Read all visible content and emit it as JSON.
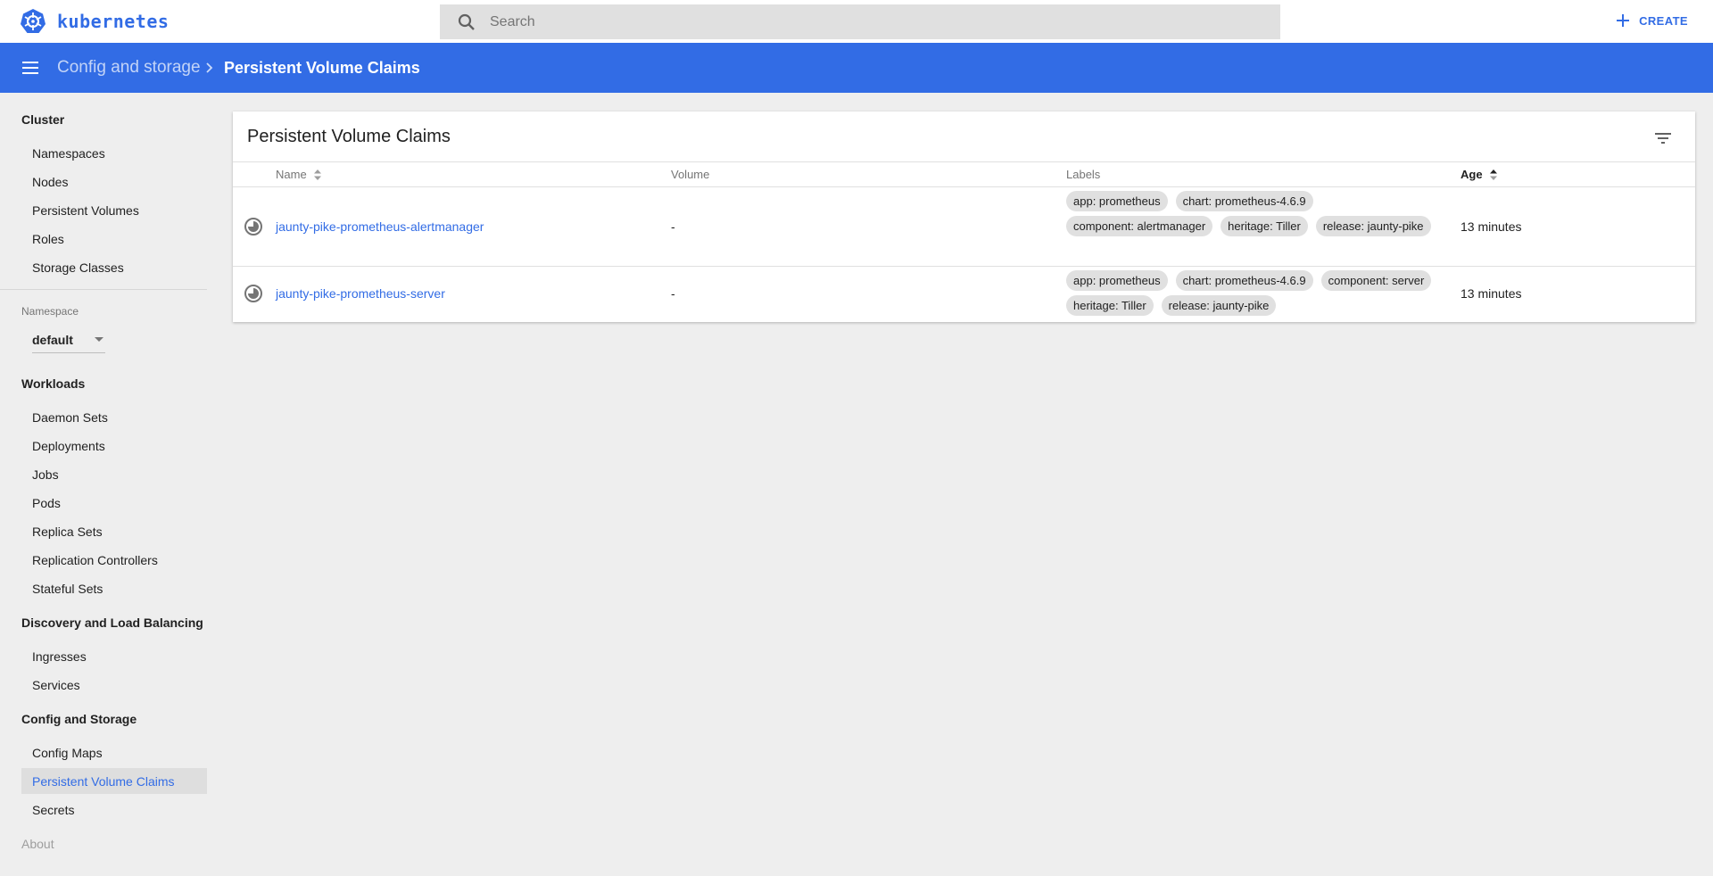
{
  "app": {
    "brand": "kubernetes",
    "create_label": "CREATE"
  },
  "search": {
    "placeholder": "Search"
  },
  "breadcrumb": {
    "parent": "Config and storage",
    "current": "Persistent Volume Claims"
  },
  "sidebar": {
    "cluster": {
      "title": "Cluster",
      "items": [
        "Namespaces",
        "Nodes",
        "Persistent Volumes",
        "Roles",
        "Storage Classes"
      ]
    },
    "namespace": {
      "label": "Namespace",
      "value": "default"
    },
    "workloads": {
      "title": "Workloads",
      "items": [
        "Daemon Sets",
        "Deployments",
        "Jobs",
        "Pods",
        "Replica Sets",
        "Replication Controllers",
        "Stateful Sets"
      ]
    },
    "discovery": {
      "title": "Discovery and Load Balancing",
      "items": [
        "Ingresses",
        "Services"
      ]
    },
    "config": {
      "title": "Config and Storage",
      "items": [
        "Config Maps",
        "Persistent Volume Claims",
        "Secrets"
      ]
    },
    "about": "About"
  },
  "table": {
    "title": "Persistent Volume Claims",
    "columns": {
      "name": "Name",
      "volume": "Volume",
      "labels": "Labels",
      "age": "Age"
    },
    "rows": [
      {
        "name": "jaunty-pike-prometheus-alertmanager",
        "volume": "-",
        "labels": [
          "app: prometheus",
          "chart: prometheus-4.6.9",
          "component: alertmanager",
          "heritage: Tiller",
          "release: jaunty-pike"
        ],
        "age": "13 minutes"
      },
      {
        "name": "jaunty-pike-prometheus-server",
        "volume": "-",
        "labels": [
          "app: prometheus",
          "chart: prometheus-4.6.9",
          "component: server",
          "heritage: Tiller",
          "release: jaunty-pike"
        ],
        "age": "13 minutes"
      }
    ]
  },
  "colors": {
    "accent": "#326ce5",
    "background": "#eeeeee",
    "chip": "#e0e0e0"
  }
}
